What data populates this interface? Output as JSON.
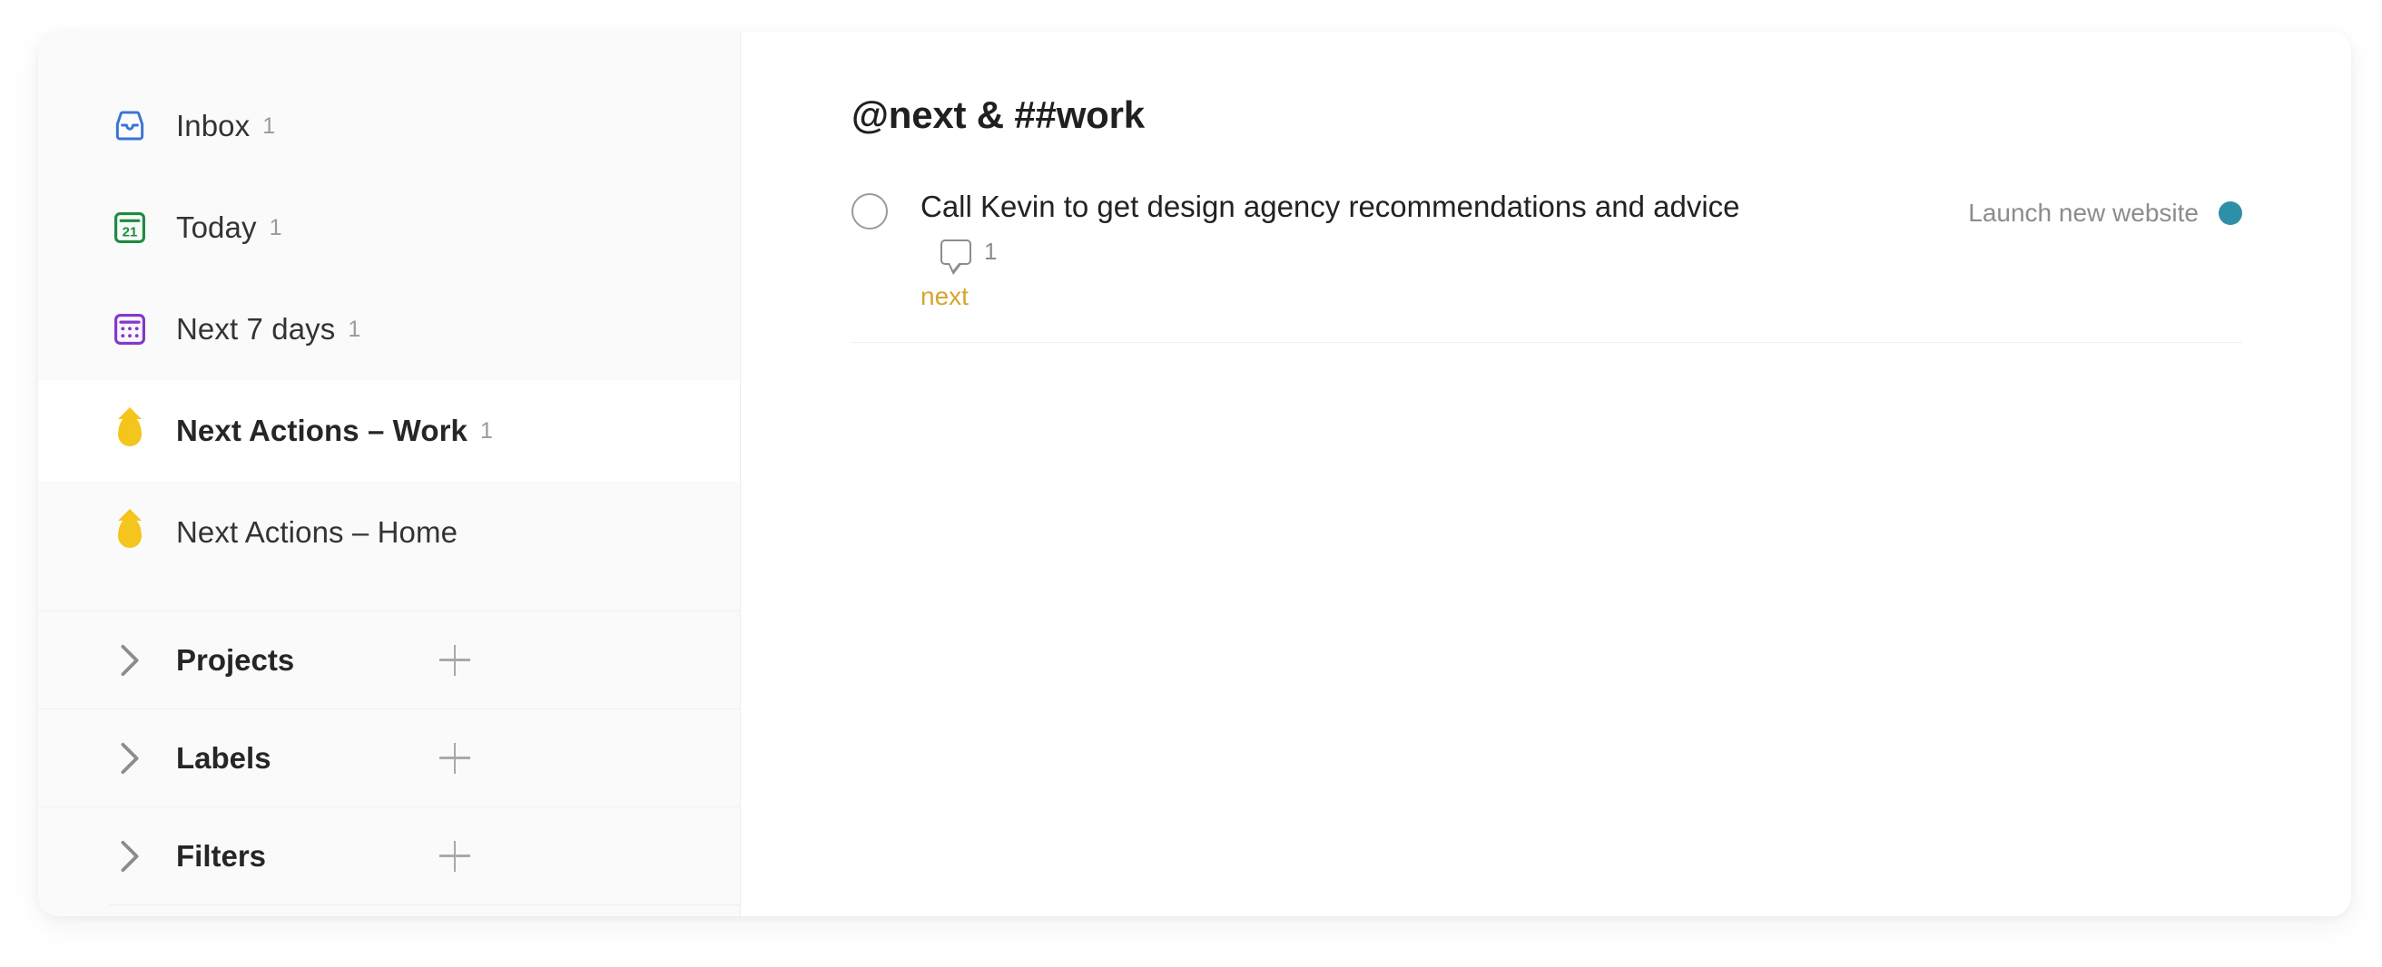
{
  "app": {
    "accent_teal": "#2e8fa8",
    "label_gold": "#d6a42f",
    "sidebar_bg": "#fafafa"
  },
  "sidebar": {
    "nav_items": [
      {
        "label": "Inbox",
        "count": "1",
        "icon": "inbox-icon",
        "icon_color": "#3b73d6",
        "selected": false
      },
      {
        "label": "Today",
        "count": "1",
        "icon": "calendar-today-icon",
        "icon_color": "#1f8a42",
        "selected": false
      },
      {
        "label": "Next 7 days",
        "count": "1",
        "icon": "calendar-week-icon",
        "icon_color": "#8338c9",
        "selected": false
      },
      {
        "label": "Next Actions – Work",
        "count": "1",
        "icon": "filter-droplet-icon",
        "icon_color": "#f4c51c",
        "selected": true
      },
      {
        "label": "Next Actions – Home",
        "count": "",
        "icon": "filter-droplet-icon",
        "icon_color": "#f4c51c",
        "selected": false
      }
    ],
    "sections": [
      {
        "title": "Projects",
        "chevron": "chevron-right-icon",
        "add": "plus-icon"
      },
      {
        "title": "Labels",
        "chevron": "chevron-right-icon",
        "add": "plus-icon"
      },
      {
        "title": "Filters",
        "chevron": "chevron-right-icon",
        "add": "plus-icon"
      }
    ]
  },
  "main": {
    "title": "@next & ##work",
    "tasks": [
      {
        "content": "Call Kevin to get design agency recommendations and advice",
        "comment_count": "1",
        "labels": [
          "next"
        ],
        "project": "Launch new website",
        "project_color": "#2e8fa8",
        "completed": false
      }
    ]
  }
}
